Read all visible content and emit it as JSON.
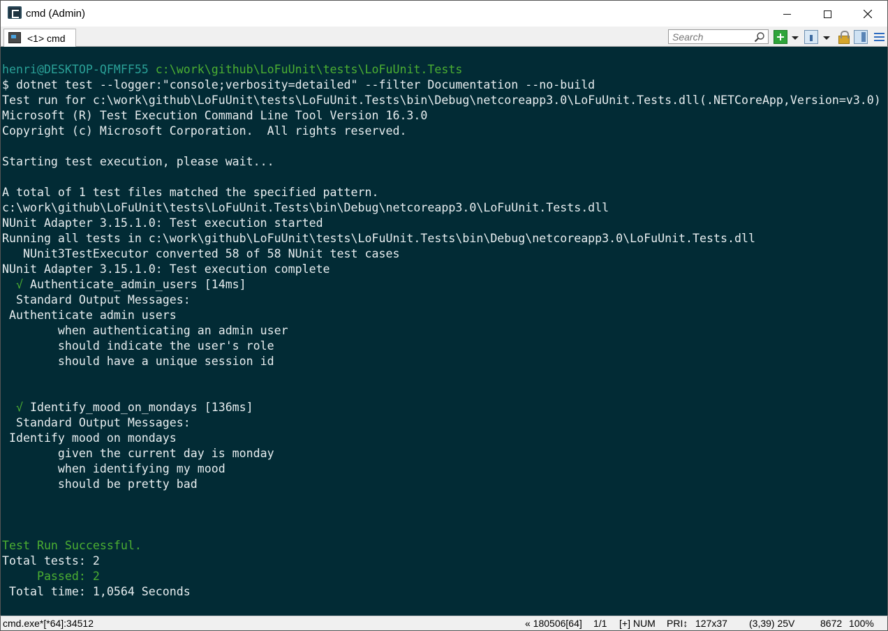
{
  "window": {
    "title": "cmd (Admin)",
    "minimize_icon": "minimize-icon",
    "maximize_icon": "maximize-icon",
    "close_icon": "close-icon"
  },
  "tabbar": {
    "tab_label": "<1> cmd",
    "search_placeholder": "Search"
  },
  "console": {
    "lines": [
      {
        "text": "",
        "color": "white"
      },
      {
        "segments": [
          {
            "text": "henri@DESKTOP-QFMFF55 ",
            "color": "teal"
          },
          {
            "text": "c:\\work\\github\\LoFuUnit\\tests\\LoFuUnit.Tests",
            "color": "green"
          }
        ]
      },
      {
        "text": "$ dotnet test --logger:\"console;verbosity=detailed\" --filter Documentation --no-build",
        "color": "white"
      },
      {
        "text": "Test run for c:\\work\\github\\LoFuUnit\\tests\\LoFuUnit.Tests\\bin\\Debug\\netcoreapp3.0\\LoFuUnit.Tests.dll(.NETCoreApp,Version=v3.0)",
        "color": "white"
      },
      {
        "text": "Microsoft (R) Test Execution Command Line Tool Version 16.3.0",
        "color": "white"
      },
      {
        "text": "Copyright (c) Microsoft Corporation.  All rights reserved.",
        "color": "white"
      },
      {
        "text": "",
        "color": "white"
      },
      {
        "text": "Starting test execution, please wait...",
        "color": "white"
      },
      {
        "text": "",
        "color": "white"
      },
      {
        "text": "A total of 1 test files matched the specified pattern.",
        "color": "white"
      },
      {
        "text": "c:\\work\\github\\LoFuUnit\\tests\\LoFuUnit.Tests\\bin\\Debug\\netcoreapp3.0\\LoFuUnit.Tests.dll",
        "color": "white"
      },
      {
        "text": "NUnit Adapter 3.15.1.0: Test execution started",
        "color": "white"
      },
      {
        "text": "Running all tests in c:\\work\\github\\LoFuUnit\\tests\\LoFuUnit.Tests\\bin\\Debug\\netcoreapp3.0\\LoFuUnit.Tests.dll",
        "color": "white"
      },
      {
        "text": "   NUnit3TestExecutor converted 58 of 58 NUnit test cases",
        "color": "white"
      },
      {
        "text": "NUnit Adapter 3.15.1.0: Test execution complete",
        "color": "white"
      },
      {
        "segments": [
          {
            "text": "  √ ",
            "color": "green"
          },
          {
            "text": "Authenticate_admin_users [14ms]",
            "color": "white"
          }
        ]
      },
      {
        "text": "  Standard Output Messages:",
        "color": "white"
      },
      {
        "text": " Authenticate admin users",
        "color": "white"
      },
      {
        "text": "        when authenticating an admin user",
        "color": "white"
      },
      {
        "text": "        should indicate the user's role",
        "color": "white"
      },
      {
        "text": "        should have a unique session id",
        "color": "white"
      },
      {
        "text": "",
        "color": "white"
      },
      {
        "text": "",
        "color": "white"
      },
      {
        "segments": [
          {
            "text": "  √ ",
            "color": "green"
          },
          {
            "text": "Identify_mood_on_mondays [136ms]",
            "color": "white"
          }
        ]
      },
      {
        "text": "  Standard Output Messages:",
        "color": "white"
      },
      {
        "text": " Identify mood on mondays",
        "color": "white"
      },
      {
        "text": "        given the current day is monday",
        "color": "white"
      },
      {
        "text": "        when identifying my mood",
        "color": "white"
      },
      {
        "text": "        should be pretty bad",
        "color": "white"
      },
      {
        "text": "",
        "color": "white"
      },
      {
        "text": "",
        "color": "white"
      },
      {
        "text": "",
        "color": "white"
      },
      {
        "text": "Test Run Successful.",
        "color": "green"
      },
      {
        "text": "Total tests: 2",
        "color": "white"
      },
      {
        "text": "     Passed: 2",
        "color": "green"
      },
      {
        "text": " Total time: 1,0564 Seconds",
        "color": "white"
      }
    ],
    "colors": {
      "background": "#022b35",
      "white": "#e8eef0",
      "teal": "#2aa198",
      "green": "#4caf32"
    }
  },
  "statusbar": {
    "process": "cmd.exe*[*64]:34512",
    "build": "« 180506[64]",
    "page": "1/1",
    "mode": "[+] NUM",
    "priority": "PRI↕",
    "size": "127x37",
    "cursor": "(3,39) 25V",
    "pid": "8672",
    "zoom": "100%"
  }
}
